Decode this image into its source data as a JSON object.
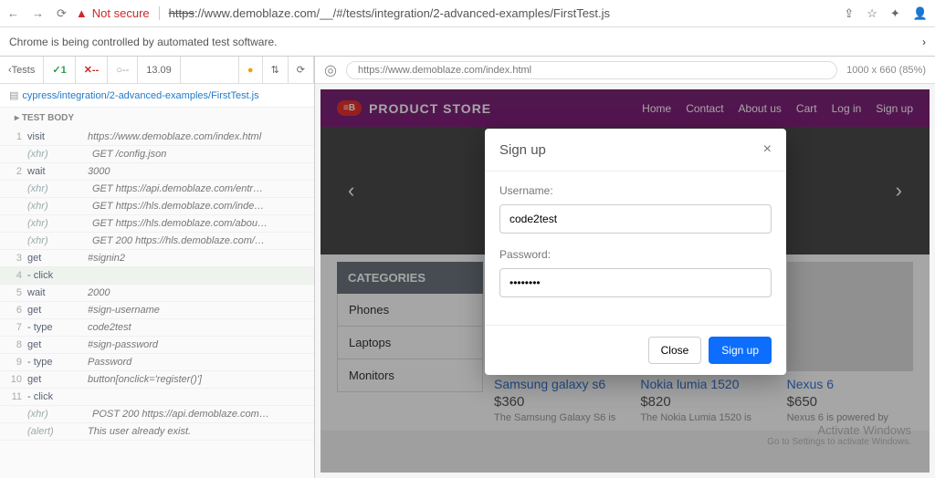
{
  "browser": {
    "not_secure": "Not secure",
    "url_strike": "https",
    "url_rest": "://www.demoblaze.com/__/#/tests/integration/2-advanced-examples/FirstTest.js"
  },
  "notice": "Chrome is being controlled by automated test software.",
  "cypress": {
    "back": "Tests",
    "pass": "1",
    "fail": "--",
    "grey": "--",
    "time": "13.09",
    "path": "cypress/integration/2-advanced-examples/FirstTest.js",
    "test_body": "TEST BODY",
    "rows": [
      {
        "n": "1",
        "cmd": "visit",
        "msg": "https://www.demoblaze.com/index.html"
      },
      {
        "n": "",
        "cmd": "(xhr)",
        "i": true,
        "dot": "grey",
        "msg": "GET /config.json"
      },
      {
        "n": "2",
        "cmd": "wait",
        "msg": "3000"
      },
      {
        "n": "",
        "cmd": "(xhr)",
        "i": true,
        "dot": "grey",
        "msg": "GET https://api.demoblaze.com/entr…"
      },
      {
        "n": "",
        "cmd": "(xhr)",
        "i": true,
        "dot": "grey",
        "msg": "GET https://hls.demoblaze.com/inde…"
      },
      {
        "n": "",
        "cmd": "(xhr)",
        "i": true,
        "dot": "grey",
        "msg": "GET https://hls.demoblaze.com/abou…"
      },
      {
        "n": "",
        "cmd": "(xhr)",
        "i": true,
        "dot": "blue",
        "msg": "GET 200 https://hls.demoblaze.com/…"
      },
      {
        "n": "3",
        "cmd": "get",
        "msg": "#signin2"
      },
      {
        "n": "4",
        "cmd": "- click",
        "hl": true,
        "msg": ""
      },
      {
        "n": "5",
        "cmd": "wait",
        "msg": "2000"
      },
      {
        "n": "6",
        "cmd": "get",
        "msg": "#sign-username"
      },
      {
        "n": "7",
        "cmd": "- type",
        "msg": "code2test"
      },
      {
        "n": "8",
        "cmd": "get",
        "msg": "#sign-password"
      },
      {
        "n": "9",
        "cmd": "- type",
        "msg": "Password"
      },
      {
        "n": "10",
        "cmd": "get",
        "msg": "button[onclick='register()']"
      },
      {
        "n": "11",
        "cmd": "- click",
        "msg": ""
      },
      {
        "n": "",
        "cmd": "(xhr)",
        "i": true,
        "dot": "blue",
        "msg": "POST 200 https://api.demoblaze.com…"
      },
      {
        "n": "",
        "cmd": "(alert)",
        "i": true,
        "msg": "This user already exist."
      }
    ]
  },
  "app": {
    "url": "https://www.demoblaze.com/index.html",
    "dim": "1000 x 660",
    "scale": "(85%)",
    "brand": "PRODUCT STORE",
    "nav": [
      "Home",
      "Contact",
      "About us",
      "Cart",
      "Log in",
      "Sign up"
    ],
    "cats_title": "CATEGORIES",
    "cats": [
      "Phones",
      "Laptops",
      "Monitors"
    ],
    "products": [
      {
        "name": "Samsung galaxy s6",
        "price": "$360",
        "desc": "The Samsung Galaxy S6 is"
      },
      {
        "name": "Nokia lumia 1520",
        "price": "$820",
        "desc": "The Nokia Lumia 1520 is"
      },
      {
        "name": "Nexus 6",
        "price": "$650",
        "desc": "Nexus 6 is powered by"
      }
    ],
    "modal": {
      "title": "Sign up",
      "user_label": "Username:",
      "user_value": "code2test",
      "pass_label": "Password:",
      "pass_value": "••••••••",
      "close": "Close",
      "signup": "Sign up"
    },
    "activate": {
      "l1": "Activate Windows",
      "l2": "Go to Settings to activate Windows."
    }
  }
}
